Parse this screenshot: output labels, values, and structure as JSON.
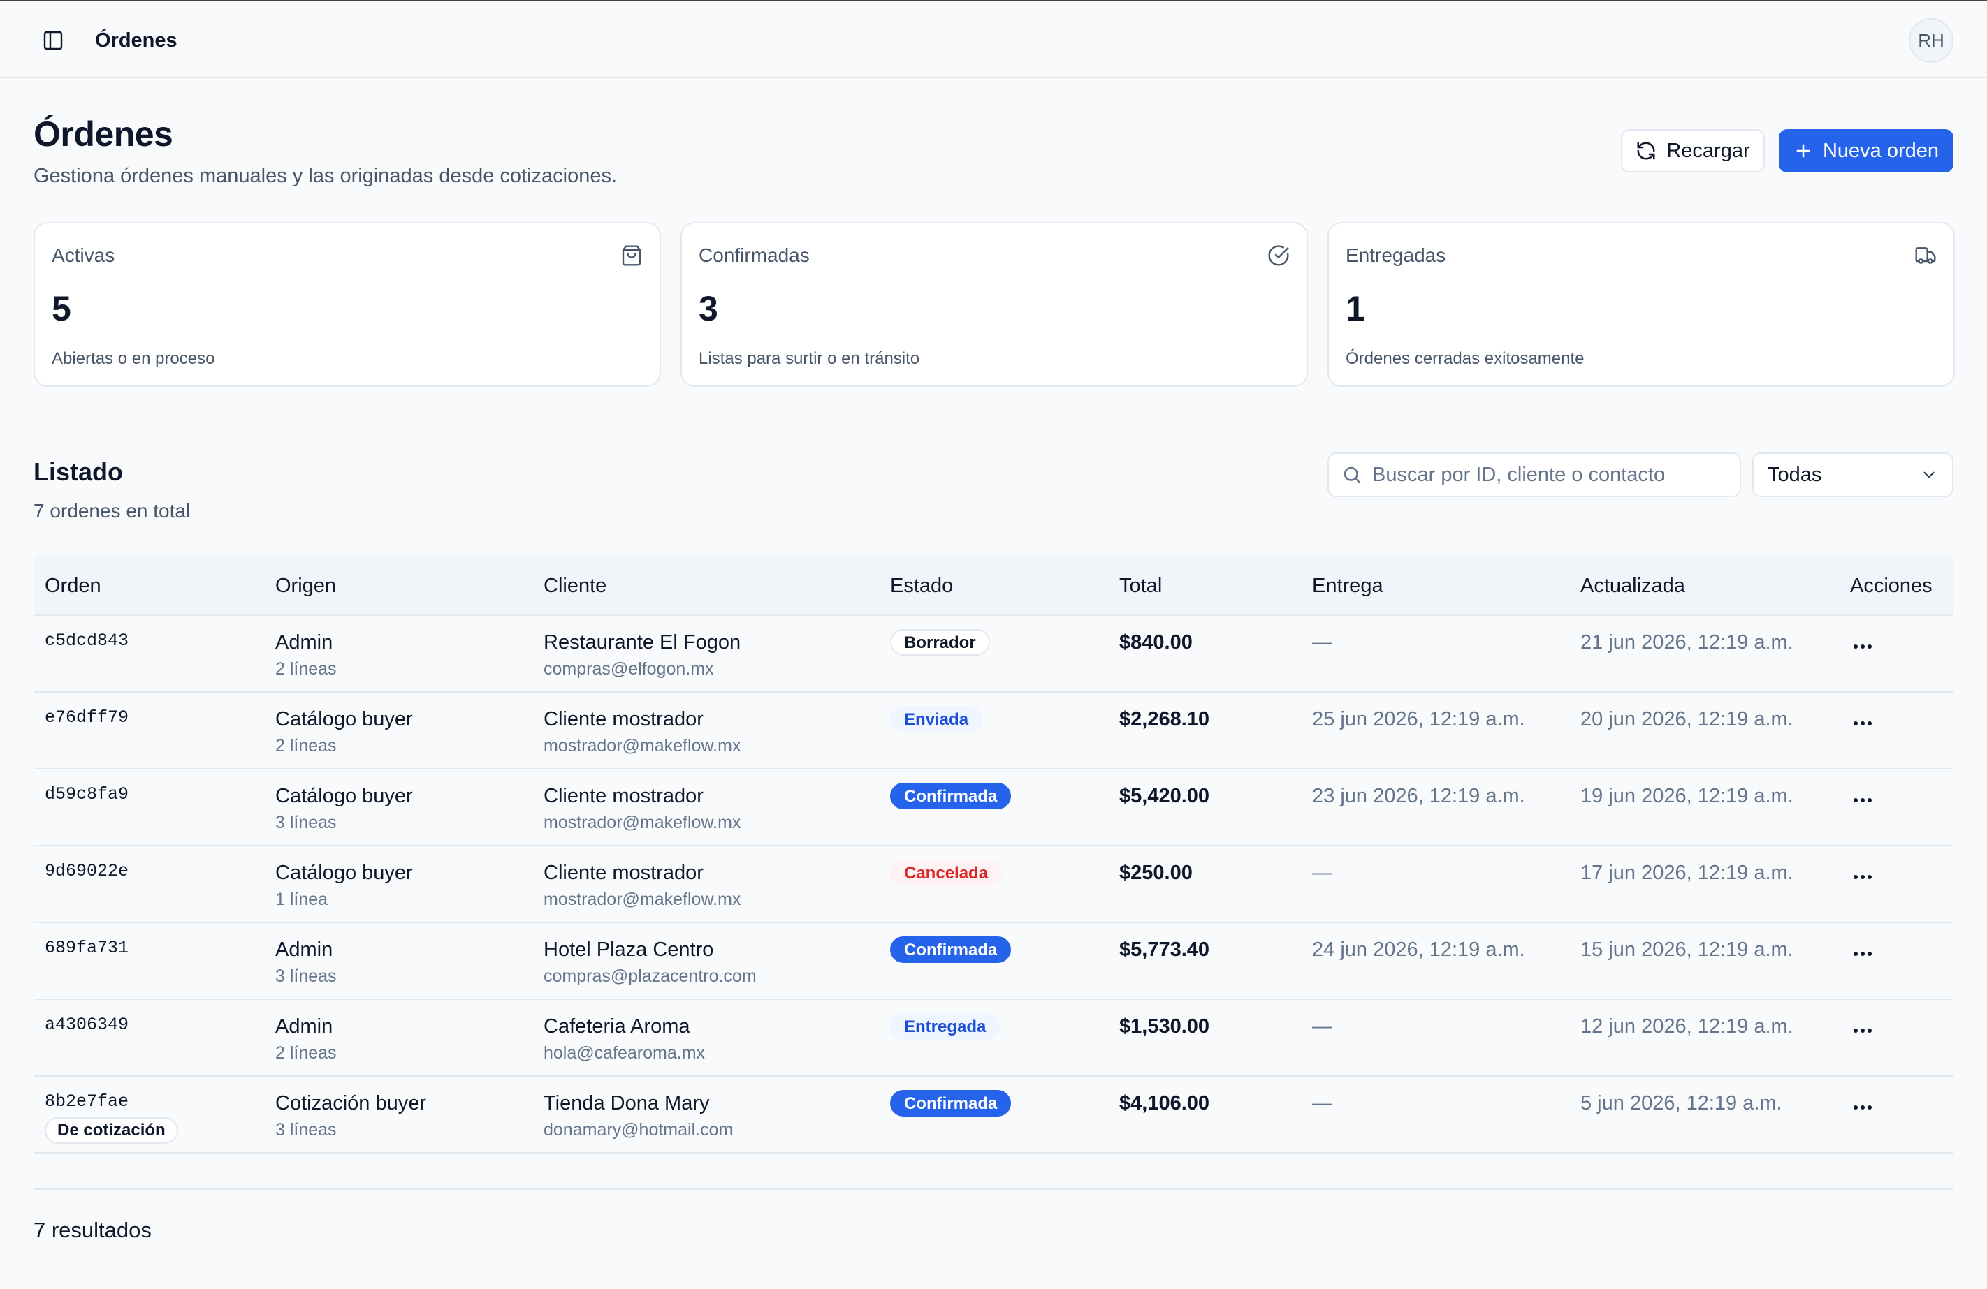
{
  "topbar": {
    "title": "Órdenes",
    "avatar_initials": "RH"
  },
  "header": {
    "title": "Órdenes",
    "subtitle": "Gestiona órdenes manuales y las originadas desde cotizaciones.",
    "reload_label": "Recargar",
    "new_label": "Nueva orden"
  },
  "stats": [
    {
      "label": "Activas",
      "value": "5",
      "description": "Abiertas o en proceso",
      "icon": "shopping-bag-icon"
    },
    {
      "label": "Confirmadas",
      "value": "3",
      "description": "Listas para surtir o en tránsito",
      "icon": "check-circle-icon"
    },
    {
      "label": "Entregadas",
      "value": "1",
      "description": "Órdenes cerradas exitosamente",
      "icon": "truck-icon"
    }
  ],
  "listing": {
    "title": "Listado",
    "count": "7 ordenes en total",
    "search_placeholder": "Buscar por ID, cliente o contacto",
    "filter_value": "Todas"
  },
  "columns": [
    "Orden",
    "Origen",
    "Cliente",
    "Estado",
    "Total",
    "Entrega",
    "Actualizada",
    "Acciones"
  ],
  "rows": [
    {
      "id": "c5dcd843",
      "tag": "",
      "origin": "Admin",
      "lines": "2 líneas",
      "client": "Restaurante El Fogon",
      "email": "compras@elfogon.mx",
      "status": "Borrador",
      "status_kind": "draft",
      "total": "$840.00",
      "delivery": "—",
      "updated": "21 jun 2026, 12:19 a.m."
    },
    {
      "id": "e76dff79",
      "tag": "",
      "origin": "Catálogo buyer",
      "lines": "2 líneas",
      "client": "Cliente mostrador",
      "email": "mostrador@makeflow.mx",
      "status": "Enviada",
      "status_kind": "sent",
      "total": "$2,268.10",
      "delivery": "25 jun 2026, 12:19 a.m.",
      "updated": "20 jun 2026, 12:19 a.m."
    },
    {
      "id": "d59c8fa9",
      "tag": "",
      "origin": "Catálogo buyer",
      "lines": "3 líneas",
      "client": "Cliente mostrador",
      "email": "mostrador@makeflow.mx",
      "status": "Confirmada",
      "status_kind": "conf",
      "total": "$5,420.00",
      "delivery": "23 jun 2026, 12:19 a.m.",
      "updated": "19 jun 2026, 12:19 a.m."
    },
    {
      "id": "9d69022e",
      "tag": "",
      "origin": "Catálogo buyer",
      "lines": "1 línea",
      "client": "Cliente mostrador",
      "email": "mostrador@makeflow.mx",
      "status": "Cancelada",
      "status_kind": "cancel",
      "total": "$250.00",
      "delivery": "—",
      "updated": "17 jun 2026, 12:19 a.m."
    },
    {
      "id": "689fa731",
      "tag": "",
      "origin": "Admin",
      "lines": "3 líneas",
      "client": "Hotel Plaza Centro",
      "email": "compras@plazacentro.com",
      "status": "Confirmada",
      "status_kind": "conf",
      "total": "$5,773.40",
      "delivery": "24 jun 2026, 12:19 a.m.",
      "updated": "15 jun 2026, 12:19 a.m."
    },
    {
      "id": "a4306349",
      "tag": "",
      "origin": "Admin",
      "lines": "2 líneas",
      "client": "Cafeteria Aroma",
      "email": "hola@cafearoma.mx",
      "status": "Entregada",
      "status_kind": "deliv",
      "total": "$1,530.00",
      "delivery": "—",
      "updated": "12 jun 2026, 12:19 a.m."
    },
    {
      "id": "8b2e7fae",
      "tag": "De cotización",
      "origin": "Cotización buyer",
      "lines": "3 líneas",
      "client": "Tienda Dona Mary",
      "email": "donamary@hotmail.com",
      "status": "Confirmada",
      "status_kind": "conf",
      "total": "$4,106.00",
      "delivery": "—",
      "updated": "5 jun 2026, 12:19 a.m."
    }
  ],
  "footer": {
    "results": "7 resultados"
  }
}
